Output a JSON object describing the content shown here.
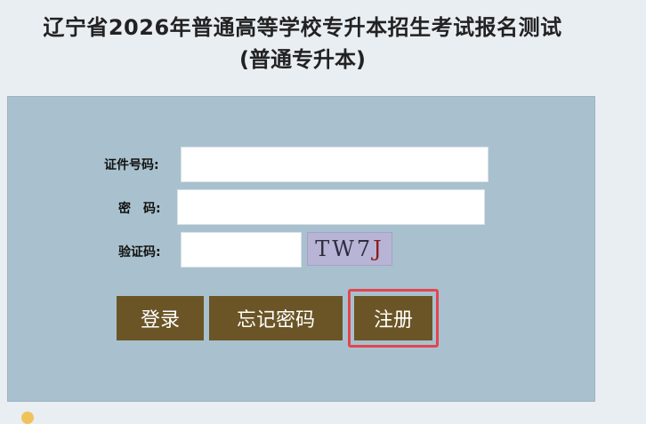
{
  "header": {
    "title_line1": "辽宁省2026年普通高等学校专升本招生考试报名测试",
    "title_line2": "(普通专升本)"
  },
  "form": {
    "id_label": "证件号码:",
    "id_value": "",
    "password_label": "密　码:",
    "password_value": "",
    "captcha_label": "验证码:",
    "captcha_value": "",
    "captcha_text_main": "TW7",
    "captcha_text_last": "J"
  },
  "buttons": {
    "login": "登录",
    "forgot_password": "忘记密码",
    "register": "注册"
  },
  "colors": {
    "page_bg": "#e9eef3",
    "panel_bg": "#a9c1ce",
    "button_bg": "#6b5526",
    "highlight": "#e3454f",
    "captcha_bg": "#b8b4d6"
  }
}
